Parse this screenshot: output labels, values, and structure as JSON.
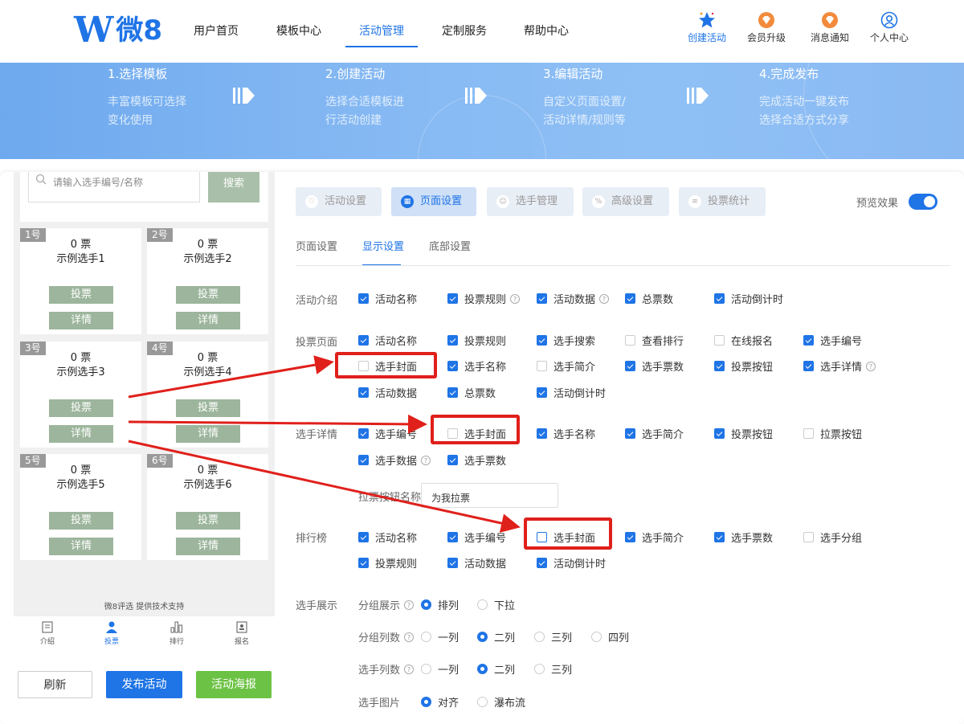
{
  "logo": {
    "mark": "W",
    "text": "微8"
  },
  "nav": [
    "用户首页",
    "模板中心",
    "活动管理",
    "定制服务",
    "帮助中心"
  ],
  "tools": [
    "创建活动",
    "会员升级",
    "消息通知",
    "个人中心"
  ],
  "steps": [
    {
      "title": "1.选择模板",
      "line1": "丰富模板可选择",
      "line2": "变化使用"
    },
    {
      "title": "2.创建活动",
      "line1": "选择合适模板进",
      "line2": "行活动创建"
    },
    {
      "title": "3.编辑活动",
      "line1": "自定义页面设置/",
      "line2": "活动详情/规则等"
    },
    {
      "title": "4.完成发布",
      "line1": "完成活动一键发布",
      "line2": "选择合适方式分享"
    }
  ],
  "preview": {
    "search_placeholder": "请输入选手编号/名称",
    "search_button": "搜索",
    "contestants": [
      {
        "num": "1号",
        "votes": "0 票",
        "name": "示例选手1"
      },
      {
        "num": "2号",
        "votes": "0 票",
        "name": "示例选手2"
      },
      {
        "num": "3号",
        "votes": "0 票",
        "name": "示例选手3"
      },
      {
        "num": "4号",
        "votes": "0 票",
        "name": "示例选手4"
      },
      {
        "num": "5号",
        "votes": "0 票",
        "name": "示例选手5"
      },
      {
        "num": "6号",
        "votes": "0 票",
        "name": "示例选手6"
      }
    ],
    "vote_label": "投票",
    "detail_label": "详情",
    "credit": "微8评选 提供技术支持",
    "tabbar": [
      "介绍",
      "投票",
      "排行",
      "报名"
    ]
  },
  "buttons": {
    "refresh": "刷新",
    "publish": "发布活动",
    "poster": "活动海报"
  },
  "top_tabs": [
    "活动设置",
    "页面设置",
    "选手管理",
    "高级设置",
    "投票统计"
  ],
  "preview_toggle": "预览效果",
  "sub_tabs": [
    "页面设置",
    "显示设置",
    "底部设置"
  ],
  "sections": {
    "intro": {
      "label": "活动介绍",
      "items": [
        "活动名称",
        "投票规则",
        "活动数据",
        "总票数",
        "活动倒计时"
      ]
    },
    "vote_page": {
      "label": "投票页面",
      "items": [
        "活动名称",
        "投票规则",
        "选手搜索",
        "查看排行",
        "在线报名",
        "选手编号",
        "选手封面",
        "选手名称",
        "选手简介",
        "选手票数",
        "投票按钮",
        "选手详情",
        "活动数据",
        "总票数",
        "活动倒计时"
      ]
    },
    "detail": {
      "label": "选手详情",
      "items": [
        "选手编号",
        "选手封面",
        "选手名称",
        "选手简介",
        "投票按钮",
        "拉票按钮",
        "选手数据",
        "选手票数"
      ],
      "canvass_label": "拉票按钮名称",
      "canvass_value": "为我拉票"
    },
    "rank": {
      "label": "排行榜",
      "items": [
        "活动名称",
        "选手编号",
        "选手封面",
        "选手简介",
        "选手票数",
        "选手分组",
        "投票规则",
        "活动数据",
        "活动倒计时"
      ]
    },
    "display": {
      "label": "选手展示",
      "group_show": {
        "label": "分组展示",
        "options": [
          "排列",
          "下拉"
        ]
      },
      "group_cols": {
        "label": "分组列数",
        "options": [
          "一列",
          "二列",
          "三列",
          "四列"
        ]
      },
      "player_cols": {
        "label": "选手列数",
        "options": [
          "一列",
          "二列",
          "三列"
        ]
      },
      "player_img": {
        "label": "选手图片",
        "options": [
          "对齐",
          "瀑布流"
        ]
      }
    }
  },
  "colors": {
    "accent": "#1f74e6",
    "highlight": "#e0201b",
    "green": "#6cc244",
    "vote_btn": "#9cb59c"
  }
}
